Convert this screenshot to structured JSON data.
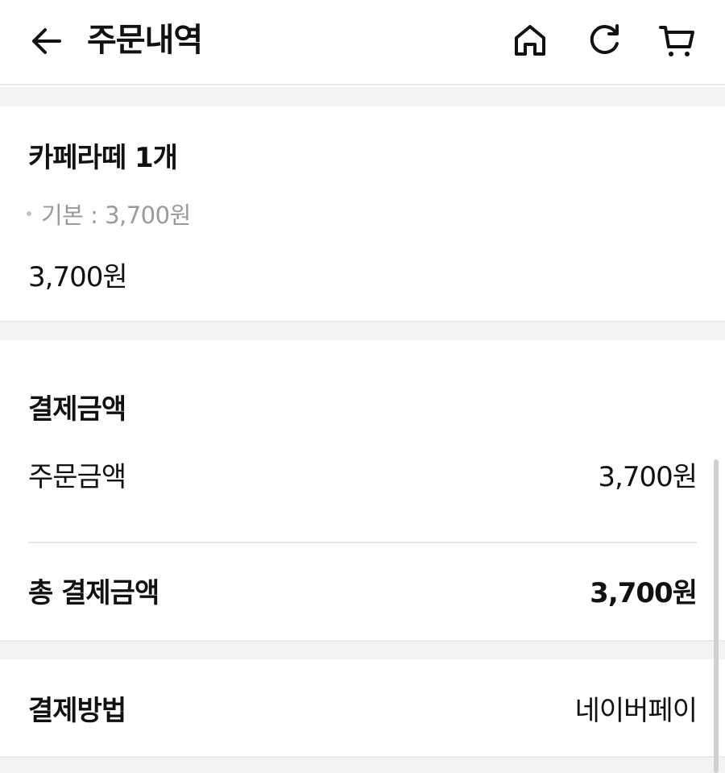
{
  "header": {
    "title": "주문내역",
    "back_icon": "arrow-left-icon",
    "home_icon": "home-icon",
    "refresh_icon": "refresh-icon",
    "cart_icon": "cart-icon"
  },
  "order_item": {
    "name": "카페라떼 1개",
    "option": "기본 : 3,700원",
    "price": "3,700원"
  },
  "payment_amount": {
    "title": "결제금액",
    "order_amount_label": "주문금액",
    "order_amount_value": "3,700원",
    "total_label": "총 결제금액",
    "total_value": "3,700원"
  },
  "payment_method": {
    "label": "결제방법",
    "value": "네이버페이"
  }
}
